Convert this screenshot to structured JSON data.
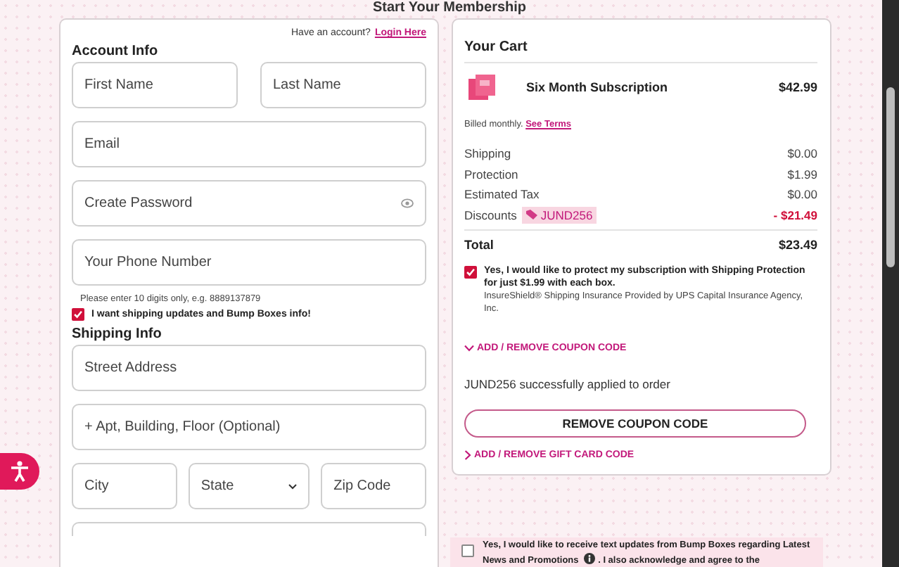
{
  "title": "Start Your Membership",
  "account_prompt": {
    "text": "Have an account?",
    "link": "Login Here"
  },
  "account": {
    "heading": "Account Info",
    "rows": [
      [
        {
          "kind": "text",
          "placeholder": "First Name"
        },
        {
          "kind": "text",
          "placeholder": "Last Name"
        }
      ],
      [
        {
          "kind": "text",
          "placeholder": "Email"
        }
      ],
      [
        {
          "kind": "password",
          "placeholder": "Create Password"
        }
      ],
      [
        {
          "kind": "text",
          "placeholder": "Your Phone Number"
        }
      ]
    ],
    "phone_hint": "Please enter 10 digits only, e.g. 8889137879",
    "updates_opt_in": {
      "label": "I want shipping updates and Bump Boxes info!",
      "checked": true
    }
  },
  "shipping": {
    "heading": "Shipping Info",
    "rows": [
      [
        {
          "kind": "text",
          "placeholder": "Street Address"
        }
      ],
      [
        {
          "kind": "text",
          "placeholder": "+ Apt, Building, Floor (Optional)"
        }
      ],
      [
        {
          "kind": "text",
          "placeholder": "City"
        },
        {
          "kind": "select",
          "placeholder": "State"
        },
        {
          "kind": "text",
          "placeholder": "Zip Code"
        }
      ],
      [
        {
          "kind": "text"
        }
      ]
    ]
  },
  "cart": {
    "title": "Your Cart",
    "item": {
      "name": "Six Month Subscription",
      "price": "$42.99"
    },
    "billing": {
      "text": "Billed monthly.",
      "link": "See Terms"
    },
    "lines": [
      {
        "kind": "plain",
        "label": "Shipping",
        "value": "$0.00"
      },
      {
        "kind": "plain",
        "label": "Protection",
        "value": "$1.99"
      },
      {
        "kind": "plain",
        "label": "Estimated Tax",
        "value": "$0.00"
      },
      {
        "kind": "discount",
        "label": "Discounts",
        "code": "JUND256",
        "value": "- $21.49"
      }
    ],
    "total": {
      "label": "Total",
      "value": "$23.49"
    },
    "protection": {
      "checked": true,
      "label": "Yes, I would like to protect my subscription with Shipping Protection for just $1.99 with each box.",
      "note": "InsureShield® Shipping Insurance Provided by UPS Capital Insurance Agency, Inc."
    },
    "coupon": {
      "label": "ADD / REMOVE COUPON CODE",
      "expanded": true,
      "message": "JUND256 successfully applied to order",
      "button": "REMOVE COUPON CODE"
    },
    "gift_card": {
      "label": "ADD / REMOVE GIFT CARD CODE",
      "expanded": false
    }
  },
  "sms_opt_in": {
    "checked": false,
    "text": "Yes, I would like to receive text updates from Bump Boxes regarding Latest News and Promotions",
    "rest": ". I also acknowledge and agree to the"
  }
}
